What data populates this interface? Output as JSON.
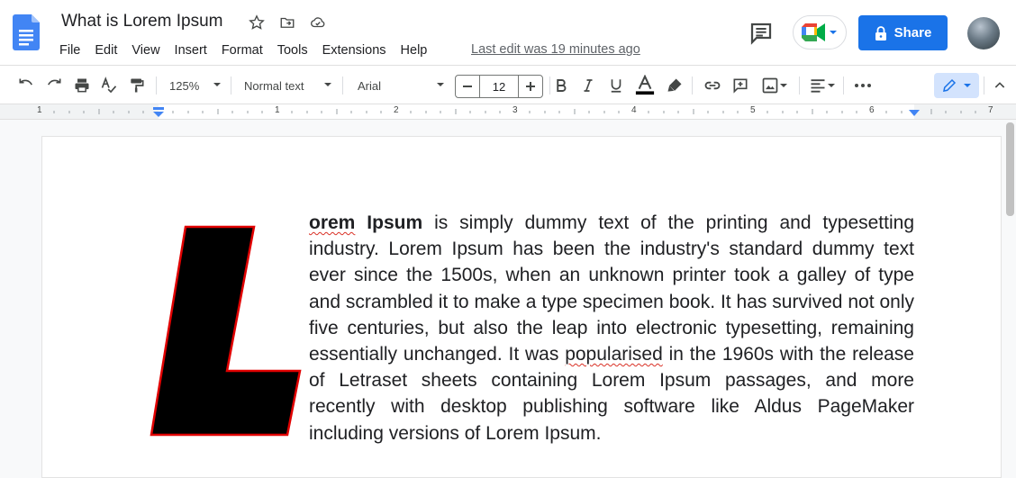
{
  "header": {
    "doc_title": "What is Lorem Ipsum",
    "menu": [
      "File",
      "Edit",
      "View",
      "Insert",
      "Format",
      "Tools",
      "Extensions",
      "Help"
    ],
    "last_edit": "Last edit was 19 minutes ago",
    "share_label": "Share"
  },
  "toolbar": {
    "zoom": "125%",
    "style": "Normal text",
    "font": "Arial",
    "font_size": "12"
  },
  "ruler": {
    "numbers": [
      "1",
      "1",
      "2",
      "3",
      "4",
      "5",
      "6",
      "7"
    ]
  },
  "document": {
    "drop_cap_letter": "L",
    "first_word": "orem",
    "bold_word2": "Ipsum",
    "text_part1": " is simply dummy text of the printing and typesetting industry. Lorem Ipsum has been the industry's standard dummy text ever since the 1500s, when an unknown printer took a galley of type and scrambled it to make a type specimen book. It has survived not only five centuries, but also the leap into electronic typesetting, remaining essentially unchanged. It was ",
    "misspelled": "popularised",
    "text_part2": " in the 1960s with the release of Letraset sheets containing Lorem Ipsum passages, and more recently with desktop publishing software like Aldus PageMaker including versions of Lorem Ipsum."
  },
  "colors": {
    "accent": "#1a73e8",
    "drop_cap_fill": "#000000",
    "drop_cap_outline": "#e00000",
    "spell_error": "#d93025"
  }
}
